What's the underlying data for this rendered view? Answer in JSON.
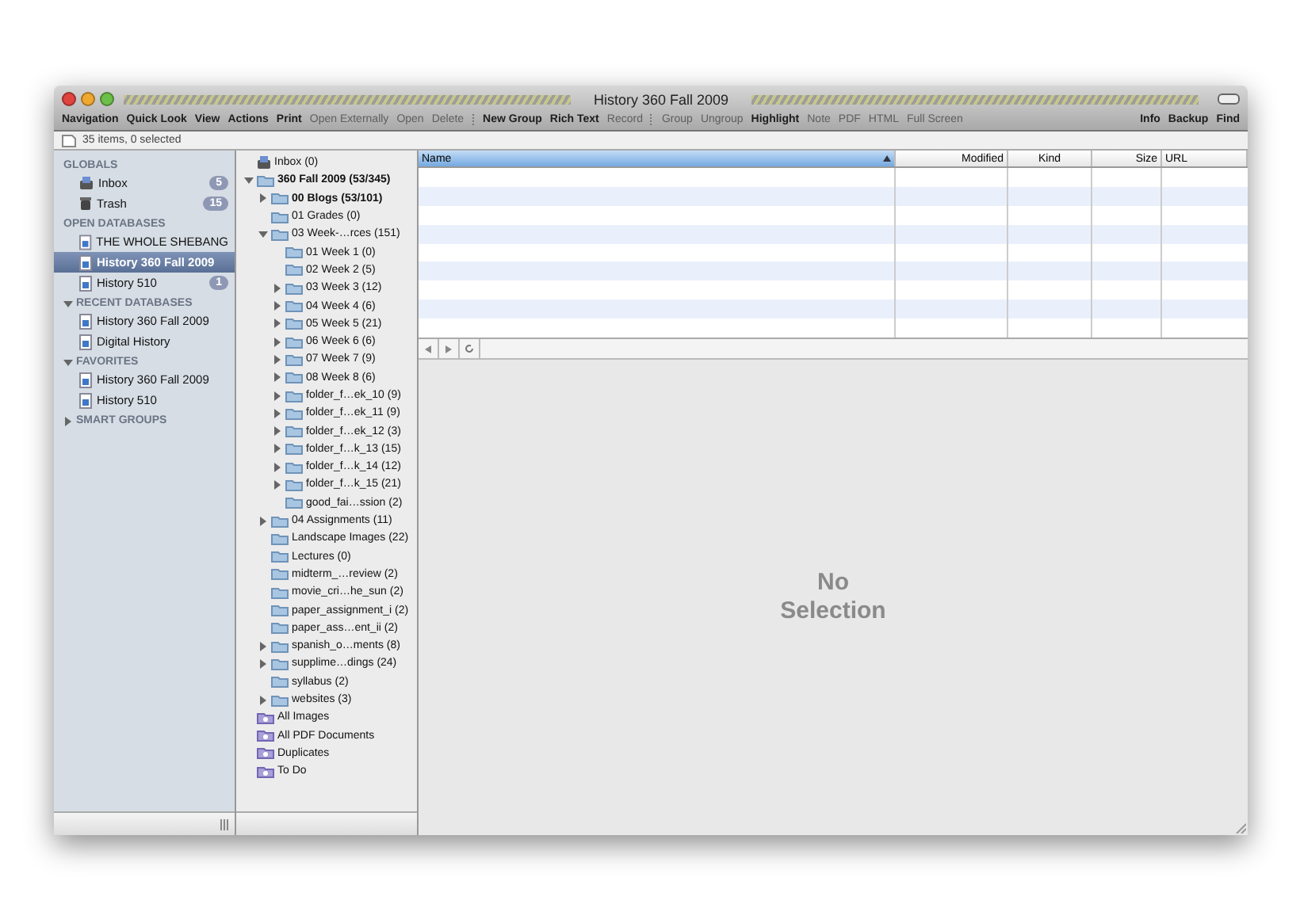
{
  "window": {
    "title": "History 360 Fall 2009"
  },
  "toolbar": {
    "left": [
      {
        "label": "Navigation",
        "disabled": false
      },
      {
        "label": "Quick Look",
        "disabled": false
      },
      {
        "label": "View",
        "disabled": false
      },
      {
        "label": "Actions",
        "disabled": false
      },
      {
        "label": "Print",
        "disabled": false
      },
      {
        "label": "Open Externally",
        "disabled": true
      },
      {
        "label": "Open",
        "disabled": true
      },
      {
        "label": "Delete",
        "disabled": true
      },
      {
        "kind": "separator"
      },
      {
        "label": "New Group",
        "disabled": false
      },
      {
        "label": "Rich Text",
        "disabled": false
      },
      {
        "label": "Record",
        "disabled": true
      },
      {
        "kind": "separator"
      },
      {
        "label": "Group",
        "disabled": true
      },
      {
        "label": "Ungroup",
        "disabled": true
      },
      {
        "label": "Highlight",
        "disabled": false
      },
      {
        "label": "Note",
        "disabled": true
      },
      {
        "label": "PDF",
        "disabled": true
      },
      {
        "label": "HTML",
        "disabled": true
      },
      {
        "label": "Full Screen",
        "disabled": true
      }
    ],
    "right": [
      {
        "label": "Info",
        "disabled": false
      },
      {
        "label": "Backup",
        "disabled": false
      },
      {
        "label": "Find",
        "disabled": false
      }
    ]
  },
  "status_bar": {
    "text": "35 items, 0 selected"
  },
  "sidebar": {
    "sections": [
      {
        "title": "GLOBALS",
        "items": [
          {
            "label": "Inbox",
            "kind": "inbox",
            "badge": "5",
            "selected": false
          },
          {
            "label": "Trash",
            "kind": "trash",
            "badge": "15",
            "selected": false
          }
        ]
      },
      {
        "title": "OPEN DATABASES",
        "items": [
          {
            "label": "THE WHOLE SHEBANG",
            "kind": "database",
            "selected": false
          },
          {
            "label": "History 360 Fall 2009",
            "kind": "database",
            "selected": true
          },
          {
            "label": "History 510",
            "kind": "database",
            "badge": "1",
            "selected": false
          }
        ]
      },
      {
        "title": "RECENT DATABASES",
        "expanded": true,
        "items": [
          {
            "label": "History 360 Fall 2009",
            "kind": "database",
            "selected": false
          },
          {
            "label": "Digital History",
            "kind": "database",
            "selected": false
          }
        ]
      },
      {
        "title": "FAVORITES",
        "expanded": true,
        "items": [
          {
            "label": "History 360 Fall 2009",
            "kind": "database",
            "selected": false
          },
          {
            "label": "History 510",
            "kind": "database",
            "selected": false
          }
        ]
      },
      {
        "title": "SMART GROUPS",
        "expanded": false
      }
    ]
  },
  "tree": [
    {
      "label": "Inbox (0)",
      "kind": "inbox"
    },
    {
      "label": "360 Fall 2009 (53/345)",
      "kind": "folder",
      "expanded": true,
      "bold": true,
      "children": [
        {
          "label": "00 Blogs (53/101)",
          "kind": "folder",
          "expanded": false,
          "bold": true
        },
        {
          "label": "01 Grades (0)",
          "kind": "folder"
        },
        {
          "label": "03 Week-…rces (151)",
          "kind": "folder",
          "expanded": true,
          "children": [
            {
              "label": "01 Week 1 (0)",
              "kind": "folder"
            },
            {
              "label": "02 Week 2 (5)",
              "kind": "folder"
            },
            {
              "label": "03 Week 3 (12)",
              "kind": "folder",
              "expanded": false
            },
            {
              "label": "04 Week 4 (6)",
              "kind": "folder",
              "expanded": false
            },
            {
              "label": "05 Week 5 (21)",
              "kind": "folder",
              "expanded": false
            },
            {
              "label": "06 Week 6 (6)",
              "kind": "folder",
              "expanded": false
            },
            {
              "label": "07 Week 7 (9)",
              "kind": "folder",
              "expanded": false
            },
            {
              "label": "08 Week 8 (6)",
              "kind": "folder",
              "expanded": false
            },
            {
              "label": "folder_f…ek_10 (9)",
              "kind": "folder",
              "expanded": false
            },
            {
              "label": "folder_f…ek_11 (9)",
              "kind": "folder",
              "expanded": false
            },
            {
              "label": "folder_f…ek_12 (3)",
              "kind": "folder",
              "expanded": false
            },
            {
              "label": "folder_f…k_13 (15)",
              "kind": "folder",
              "expanded": false
            },
            {
              "label": "folder_f…k_14 (12)",
              "kind": "folder",
              "expanded": false
            },
            {
              "label": "folder_f…k_15 (21)",
              "kind": "folder",
              "expanded": false
            },
            {
              "label": "good_fai…ssion (2)",
              "kind": "folder"
            }
          ]
        },
        {
          "label": "04 Assignments (11)",
          "kind": "folder",
          "expanded": false
        },
        {
          "label": "Landscape Images (22)",
          "kind": "folder"
        },
        {
          "label": "Lectures (0)",
          "kind": "folder"
        },
        {
          "label": "midterm_…review (2)",
          "kind": "folder"
        },
        {
          "label": "movie_cri…he_sun (2)",
          "kind": "folder"
        },
        {
          "label": "paper_assignment_i (2)",
          "kind": "folder"
        },
        {
          "label": "paper_ass…ent_ii (2)",
          "kind": "folder"
        },
        {
          "label": "spanish_o…ments (8)",
          "kind": "folder",
          "expanded": false
        },
        {
          "label": "supplime…dings (24)",
          "kind": "folder",
          "expanded": false
        },
        {
          "label": "syllabus (2)",
          "kind": "folder"
        },
        {
          "label": "websites (3)",
          "kind": "folder",
          "expanded": false
        }
      ]
    },
    {
      "label": "All Images",
      "kind": "smart"
    },
    {
      "label": "All PDF Documents",
      "kind": "smart"
    },
    {
      "label": "Duplicates",
      "kind": "smart"
    },
    {
      "label": "To Do",
      "kind": "smart"
    }
  ],
  "table": {
    "columns": [
      {
        "label": "Name",
        "selected": true
      },
      {
        "label": "Modified",
        "selected": false
      },
      {
        "label": "Kind",
        "selected": false
      },
      {
        "label": "Size",
        "selected": false
      },
      {
        "label": "URL",
        "selected": false
      }
    ]
  },
  "preview": {
    "text": "No Selection"
  }
}
